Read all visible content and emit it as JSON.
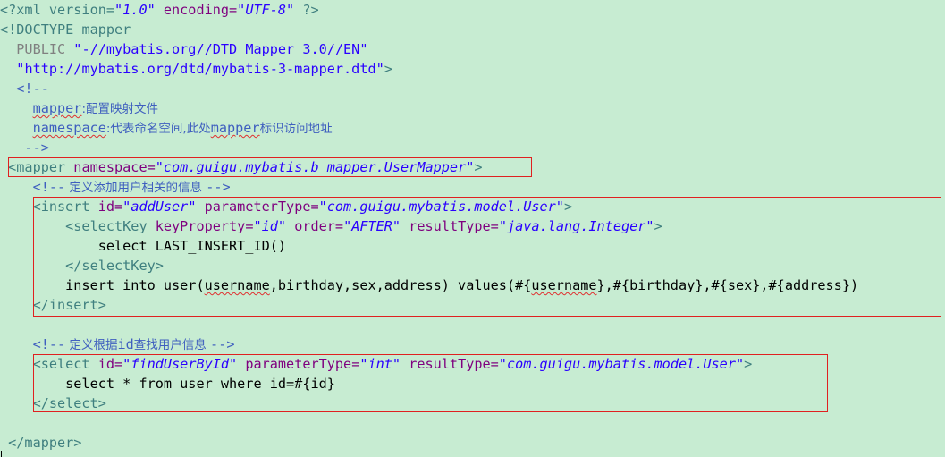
{
  "editor": {
    "lines": {
      "l1": {
        "a": "<?xml version=",
        "b": "\"1.0\"",
        "c": " encoding=",
        "d": "\"UTF-8\"",
        "e": " ?>"
      },
      "l2": {
        "a": "<!DOCTYPE",
        "b": " mapper"
      },
      "l3": {
        "a": "  PUBLIC ",
        "b": "\"-//mybatis.org//DTD Mapper 3.0//EN\""
      },
      "l4": {
        "a": "  ",
        "b": "\"http://mybatis.org/dtd/mybatis-3-mapper.dtd\"",
        "c": ">"
      },
      "l5": {
        "a": "  <!--"
      },
      "l6": {
        "a": "    ",
        "b": "mapper",
        "c": ":配置映射文件"
      },
      "l7": {
        "a": "    ",
        "b": "namespace",
        "c": ":代表命名空间,此处",
        "d": "mapper",
        "e": "标识访问地址"
      },
      "l8": {
        "a": "   -->"
      },
      "l9": {
        "a": " <mapper",
        "b": " namespace=",
        "c": "\"com.guigu.mybatis.b mapper.UserMapper\"",
        "d": ">"
      },
      "l10": {
        "a": "    <!--",
        "b": " 定义添加用户相关的信息 ",
        "c": "-->"
      },
      "l11": {
        "a": "    <insert",
        "b": " id=",
        "c": "\"addUser\"",
        "d": " parameterType=",
        "e": "\"com.guigu.mybatis.model.User\"",
        "f": ">"
      },
      "l12": {
        "a": "        <selectKey",
        "b": " keyProperty=",
        "c": "\"id\"",
        "d": " order=",
        "e": "\"AFTER\"",
        "f": " resultType=",
        "g": "\"java.lang.Integer\"",
        "h": ">"
      },
      "l13": {
        "a": "            select LAST_INSERT_ID()"
      },
      "l14": {
        "a": "        </selectKey>"
      },
      "l15": {
        "a": "        insert into user(",
        "b": "username",
        "c": ",birthday,sex,address) values(#{",
        "d": "username",
        "e": "},#{birthday},#{sex},#{address})"
      },
      "l16": {
        "a": "    </insert>"
      },
      "l17": {
        "a": "    <!--",
        "b": " 定义根据",
        "c": "id",
        "d": "查找用户信息 ",
        "e": "-->"
      },
      "l18": {
        "a": "    <select",
        "b": " id=",
        "c": "\"findUserById\"",
        "d": " parameterType=",
        "e": "\"int\"",
        "f": " resultType=",
        "g": "\"com.guigu.mybatis.model.User\"",
        "h": ">"
      },
      "l19": {
        "a": "        select * from user where id=#{id}"
      },
      "l20": {
        "a": "    </select>"
      },
      "l21": {
        "a": " </mapper>"
      }
    },
    "colors": {
      "background": "#c7ecd2",
      "tag": "#3f7f7f",
      "attribute": "#7f007f",
      "value": "#2a00ff",
      "comment": "#3f5fbf",
      "highlight_box": "#e02020"
    }
  }
}
